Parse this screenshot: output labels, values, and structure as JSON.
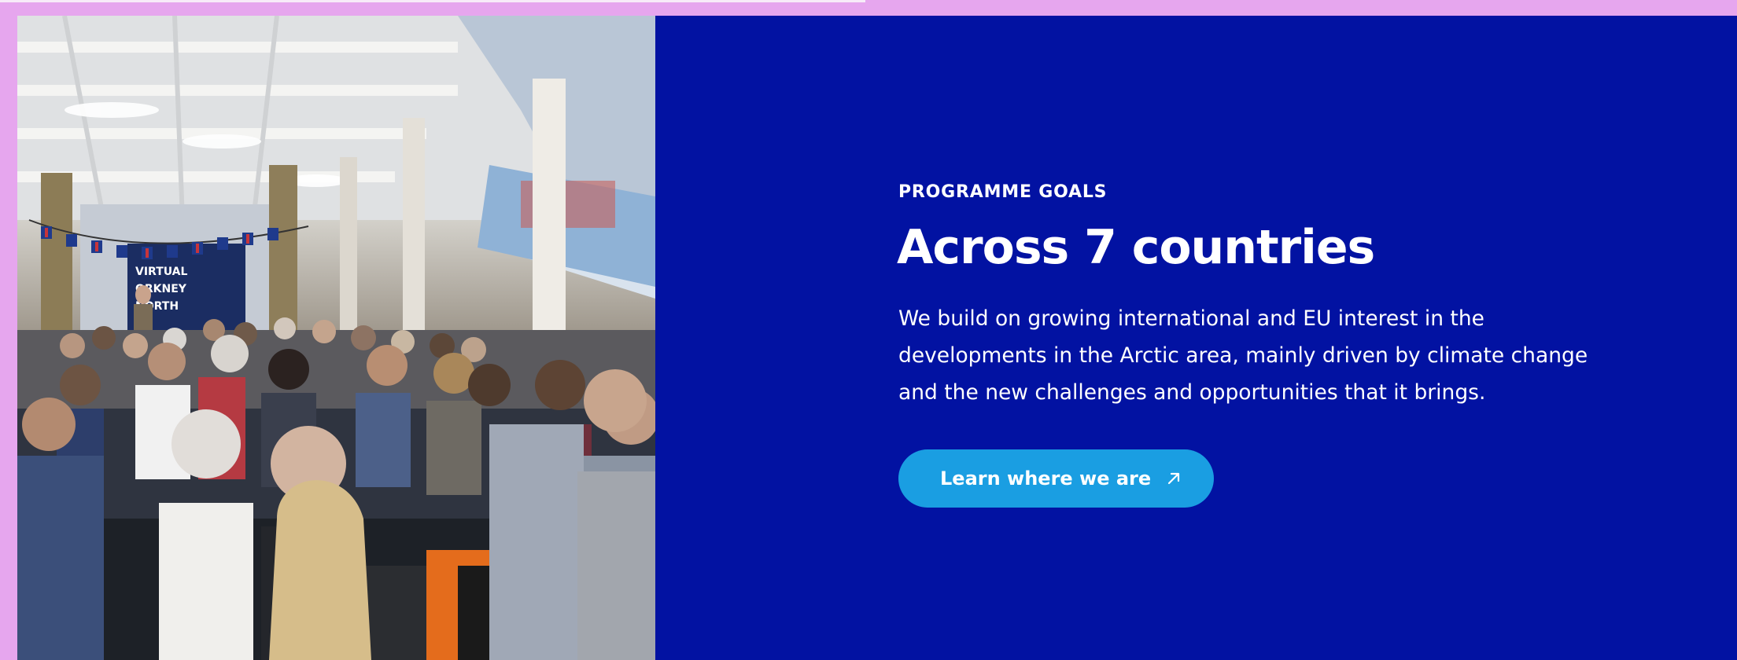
{
  "section": {
    "eyebrow": "PROGRAMME GOALS",
    "heading": "Across 7 countries",
    "body": "We build on growing international and EU interest in the developments in the Arctic area, mainly driven by climate change and the new challenges and opportunities that it brings.",
    "cta": {
      "label": "Learn where we are",
      "icon": "arrow-up-right-icon"
    }
  },
  "photo": {
    "alt": "Conference audience seated in a hall",
    "screen_text": [
      "VIRTUAL",
      "ORKNEY",
      "NORTH"
    ]
  },
  "colors": {
    "frame": "#e6a6ee",
    "panel_background": "#0212a2",
    "button_background": "#1a9ee2",
    "text": "#ffffff"
  }
}
